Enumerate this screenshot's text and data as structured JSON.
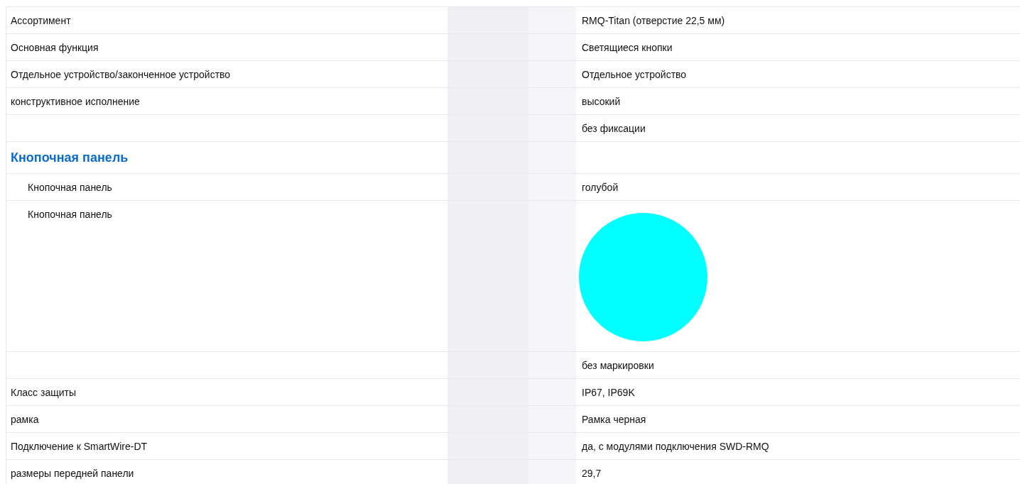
{
  "rows": [
    {
      "kind": "row",
      "label": "Ассортимент",
      "value": "RMQ-Titan (отверстие 22,5 мм)"
    },
    {
      "kind": "row",
      "label": "Основная функция",
      "value": "Светящиеся кнопки"
    },
    {
      "kind": "row",
      "label": "Отдельное устройство/законченное устройство",
      "value": "Отдельное устройство"
    },
    {
      "kind": "row",
      "label": "конструктивное исполнение",
      "value": "высокий"
    },
    {
      "kind": "row",
      "value": "без фиксации"
    },
    {
      "kind": "section",
      "label": "Кнопочная панель",
      "children": [
        {
          "kind": "row",
          "label": "Кнопочная панель",
          "value": "голубой"
        },
        {
          "kind": "swatch",
          "label": "Кнопочная панель",
          "color": "#00ffff"
        }
      ]
    },
    {
      "kind": "row",
      "value": "без маркировки"
    },
    {
      "kind": "row",
      "label": "Класс защиты",
      "value": "IP67, IP69K"
    },
    {
      "kind": "row",
      "label": "рамка",
      "value": "Рамка черная"
    },
    {
      "kind": "row",
      "label": "Подключение к SmartWire-DT",
      "value": "да, с модулями подключения SWD-RMQ"
    },
    {
      "kind": "row",
      "label": "размеры передней панели",
      "value": "29,7"
    }
  ]
}
